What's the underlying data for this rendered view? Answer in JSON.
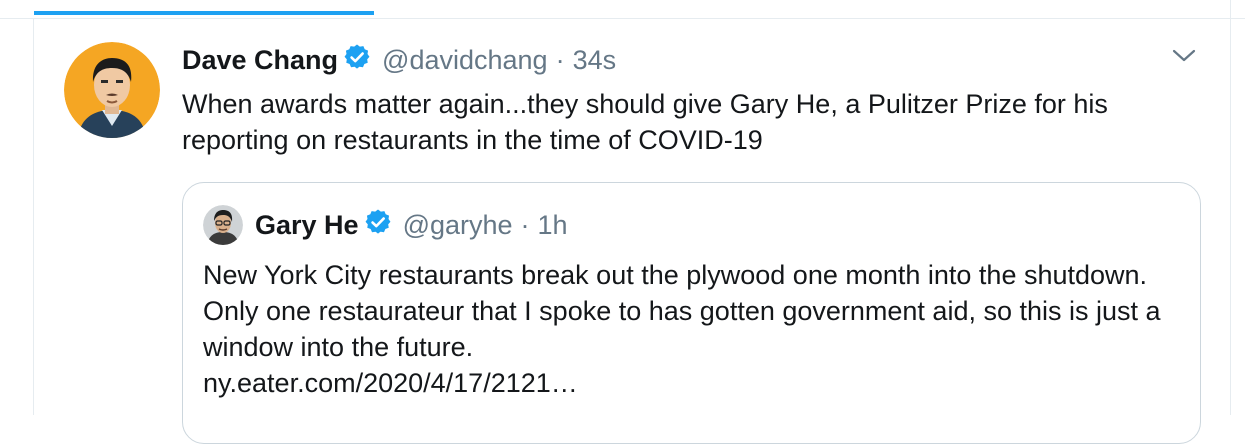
{
  "tweet": {
    "display_name": "Dave Chang",
    "handle": "@davidchang",
    "separator": "·",
    "time": "34s",
    "text": "When awards matter again...they should give Gary He, a Pulitzer Prize for his reporting on restaurants in the time of COVID-19",
    "avatar_icon": "cartoon-avatar-icon",
    "verified_icon": "verified-badge-icon",
    "menu_icon": "chevron-down-icon"
  },
  "quoted_tweet": {
    "display_name": "Gary He",
    "handle": "@garyhe",
    "separator": "·",
    "time": "1h",
    "text": "New York City restaurants break out the plywood one month into the shutdown. Only one restaurateur that I spoke to has gotten government aid, so this is just a window into the future.",
    "link": "ny.eater.com/2020/4/17/2121…",
    "avatar_icon": "profile-photo-icon"
  },
  "colors": {
    "accent": "#1da1f2",
    "text_primary": "#14171a",
    "text_secondary": "#657786",
    "border": "#ccd6dd",
    "avatar_bg": "#f5a623"
  }
}
